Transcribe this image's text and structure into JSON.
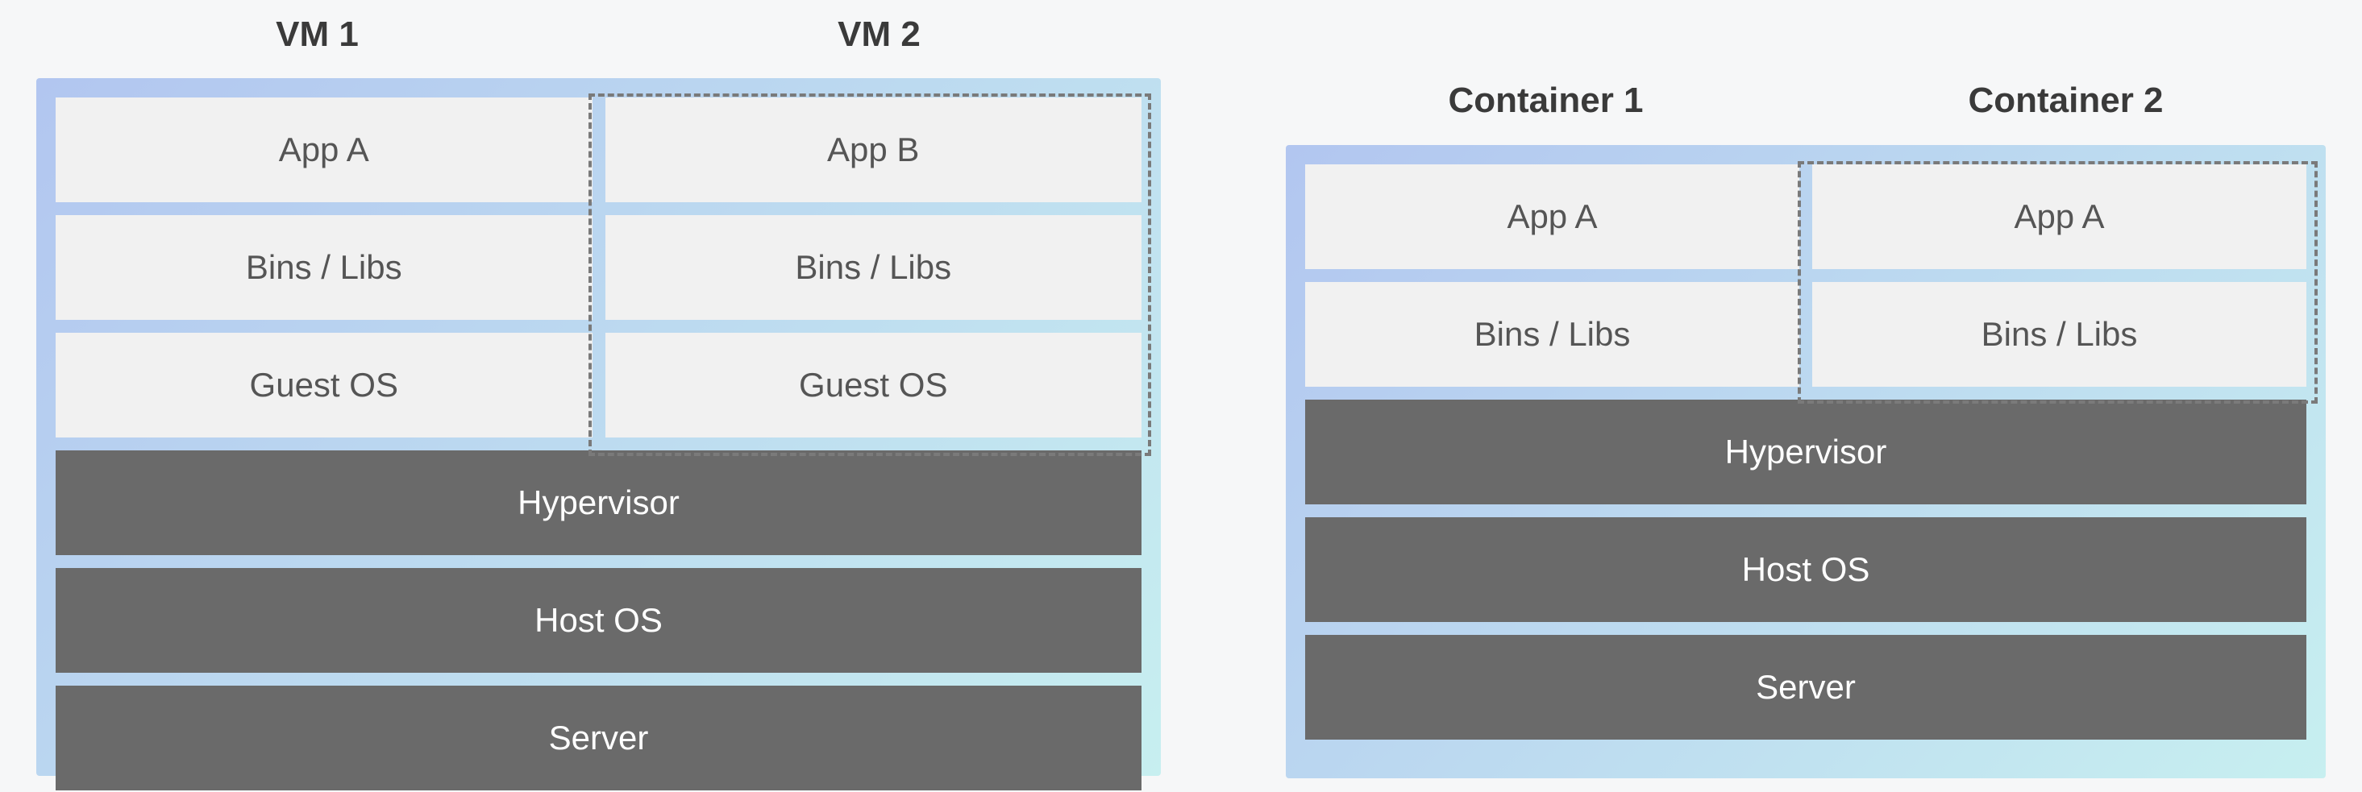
{
  "left": {
    "headers": {
      "col1": "VM 1",
      "col2": "VM 2"
    },
    "rows": [
      {
        "col1": "App A",
        "col2": "App B"
      },
      {
        "col1": "Bins / Libs",
        "col2": "Bins / Libs"
      },
      {
        "col1": "Guest OS",
        "col2": "Guest OS"
      }
    ],
    "base": [
      "Hypervisor",
      "Host OS",
      "Server"
    ]
  },
  "right": {
    "headers": {
      "col1": "Container 1",
      "col2": "Container 2"
    },
    "rows": [
      {
        "col1": "App A",
        "col2": "App A"
      },
      {
        "col1": "Bins / Libs",
        "col2": "Bins / Libs"
      }
    ],
    "base": [
      "Hypervisor",
      "Host OS",
      "Server"
    ]
  }
}
